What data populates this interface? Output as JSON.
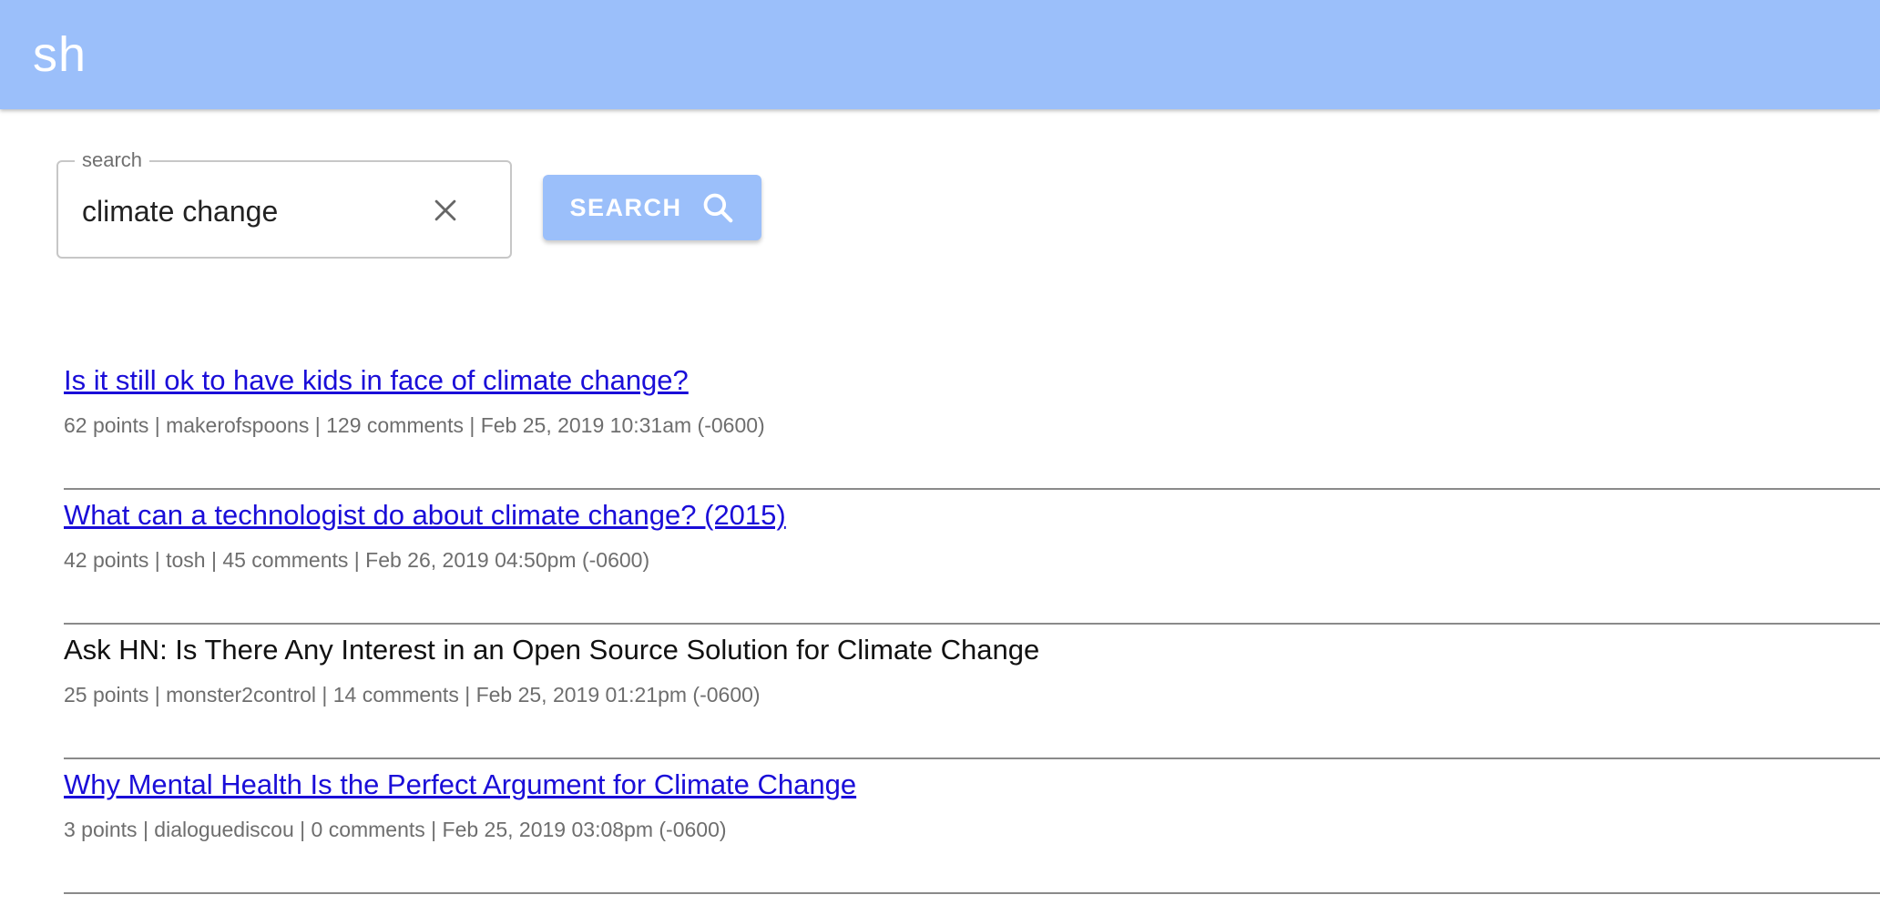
{
  "app": {
    "logo": "sh"
  },
  "search": {
    "legend": "search",
    "value": "climate change",
    "clear_icon": "close-icon",
    "button_label": "SEARCH",
    "button_icon": "search-icon"
  },
  "colors": {
    "appbar": "#9bbffa",
    "link": "#1a0dd8",
    "meta": "#6e6e6e"
  },
  "results": [
    {
      "title": "Is it still ok to have kids in face of climate change?",
      "is_link": true,
      "meta": "62 points | makerofspoons | 129 comments | Feb 25, 2019 10:31am (-0600)"
    },
    {
      "title": "What can a technologist do about climate change? (2015)",
      "is_link": true,
      "meta": "42 points | tosh | 45 comments | Feb 26, 2019 04:50pm (-0600)"
    },
    {
      "title": "Ask HN: Is There Any Interest in an Open Source Solution for Climate Change",
      "is_link": false,
      "meta": "25 points | monster2control | 14 comments | Feb 25, 2019 01:21pm (-0600)"
    },
    {
      "title": "Why Mental Health Is the Perfect Argument for Climate Change",
      "is_link": true,
      "meta": "3 points | dialoguediscou | 0 comments | Feb 25, 2019 03:08pm (-0600)"
    }
  ]
}
